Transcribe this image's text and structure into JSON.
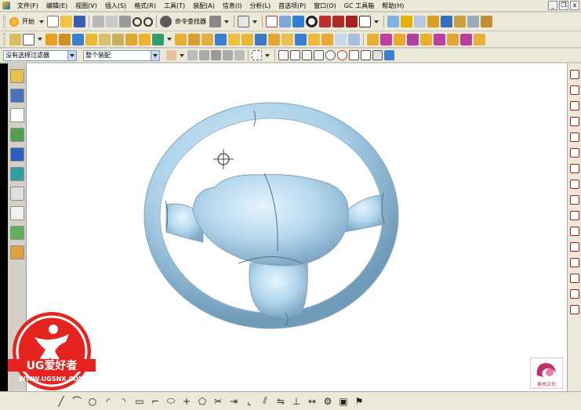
{
  "app": {
    "icon": "nx-app-icon"
  },
  "menu": {
    "items": [
      "文件(F)",
      "编辑(E)",
      "视图(V)",
      "插入(S)",
      "格式(R)",
      "工具(T)",
      "装配(A)",
      "信息(I)",
      "分析(L)",
      "首选项(P)",
      "窗口(O)",
      "GC 工具箱",
      "帮助(H)"
    ]
  },
  "window_controls": {
    "minimize": "_",
    "restore": "❐",
    "close": "x"
  },
  "toolbar_standard": {
    "start_label": "开始",
    "command_finder_label": "命令查找器"
  },
  "selection_bar": {
    "filter_value": "没有选择过滤器",
    "scope_value": "整个装配"
  },
  "resource_bar": {
    "buttons": [
      "assembly-navigator-icon",
      "constraint-navigator-icon",
      "part-navigator-icon",
      "reuse-library-icon",
      "web-browser-icon",
      "history-icon",
      "system-materials-icon",
      "process-studio-icon",
      "manufacturing-wizard-icon",
      "roles-icon"
    ]
  },
  "viewport": {
    "model": "steering-wheel",
    "model_color": "#a9d0e8",
    "background": "#ffffff"
  },
  "watermark": {
    "brand_text": "UG爱好者",
    "url_text": "WWW.UGSNX.COM",
    "corner_logo_text": "善由文化"
  },
  "colors": {
    "accent": "#1560c8",
    "watermark_red": "#e52420"
  }
}
